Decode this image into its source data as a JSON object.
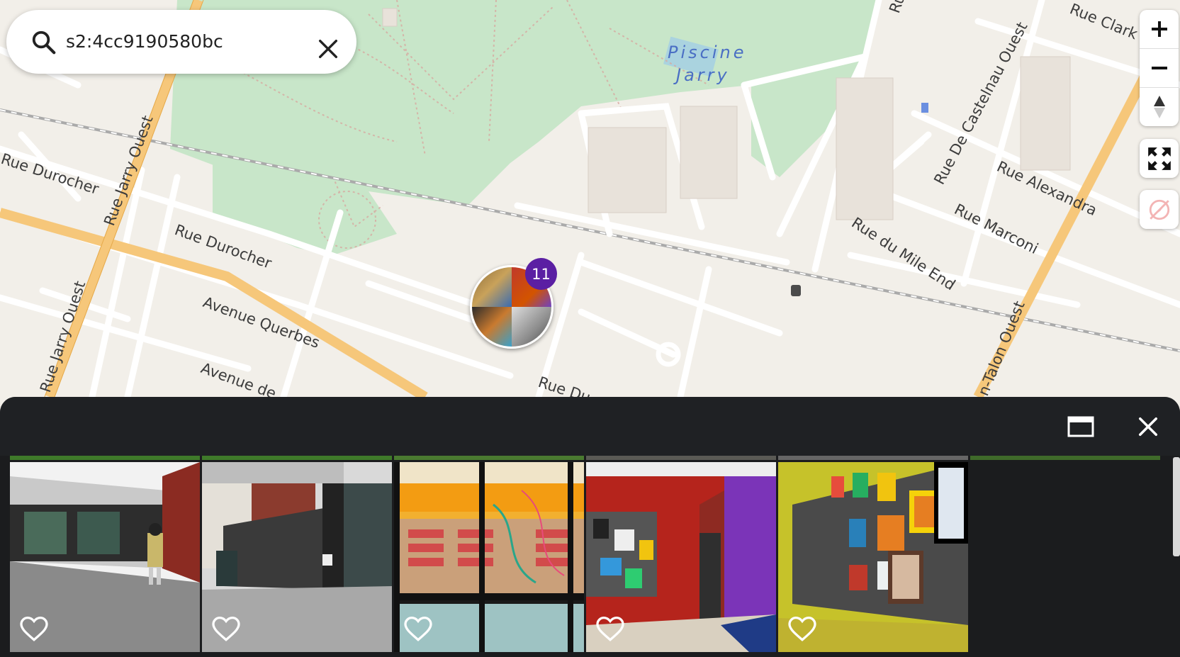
{
  "search": {
    "value": "s2:4cc9190580bc",
    "placeholder": "Search"
  },
  "map": {
    "streets": [
      "Rue Durocher",
      "Rue Durocher",
      "Rue Jarry Ouest",
      "Rue Jarry Ouest",
      "Avenue Querbes",
      "Avenue de",
      "Rue Du",
      "Rue Clark",
      "Rue De Castelnаu Ouest",
      "Rue Alexandra",
      "Rue Marconi",
      "Rue du Mile End",
      "n-Talon Ouest",
      "Ru"
    ],
    "water_label_line1": "Piscine",
    "water_label_line2": "Jarry",
    "cluster_count": "11",
    "colors": {
      "park": "#c8e6c9",
      "road_major": "#f6c77a",
      "road_minor": "#ffffff",
      "land": "#f2efe9",
      "cluster_badge": "#5b1fa3"
    }
  },
  "controls": {
    "zoom_in_icon": "plus-icon",
    "zoom_out_icon": "minus-icon",
    "compass_icon": "compass-icon",
    "fullscreen_icon": "fullscreen-icon",
    "geolocate_icon": "geolocate-disabled-icon"
  },
  "panel": {
    "window_icon": "window-icon",
    "close_icon": "close-icon",
    "thumbnails": [
      {
        "subject": "library exterior with person walking",
        "liked": false
      },
      {
        "subject": "brick building entrance",
        "liked": false
      },
      {
        "subject": "library interior through glass",
        "liked": false
      },
      {
        "subject": "red and purple hallway with artwork",
        "liked": false
      },
      {
        "subject": "yellow wall with children's artwork",
        "liked": false
      }
    ]
  }
}
